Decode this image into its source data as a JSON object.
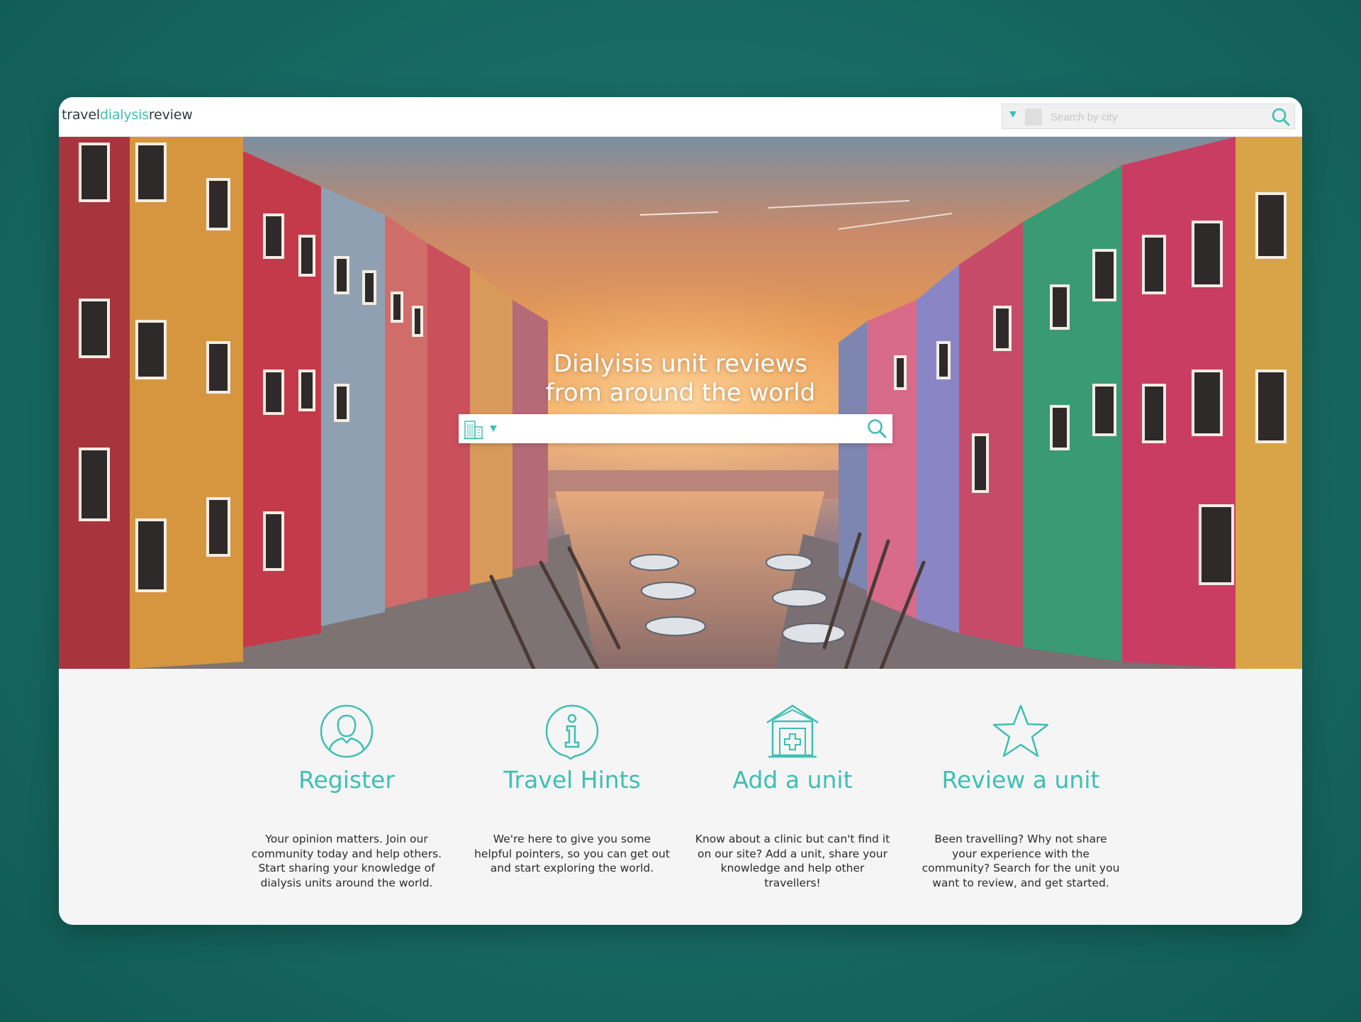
{
  "colors": {
    "accent": "#3fbfb3",
    "background": "#176a63",
    "card": "#f5f5f5",
    "text": "#2b2b2b"
  },
  "header": {
    "logo_parts": [
      "travel",
      "dialysis",
      "review"
    ],
    "search_placeholder": "Search by city",
    "search_icon": "search-icon"
  },
  "hero": {
    "title_line1": "Dialyisis unit reviews",
    "title_line2": "from around the world",
    "search_type_icon": "building-icon",
    "search_icon": "search-icon",
    "search_value": ""
  },
  "features": [
    {
      "icon": "user-icon",
      "title": "Register",
      "description": "Your opinion matters. Join our community today and help others. Start sharing your knowledge of dialysis units around the world."
    },
    {
      "icon": "info-icon",
      "title": "Travel Hints",
      "description": "We're here to give you some helpful pointers, so you can get out and start exploring the world."
    },
    {
      "icon": "clinic-icon",
      "title": "Add a unit",
      "description": "Know about a clinic but can't find it on our site? Add a unit, share your knowledge and help other travellers!"
    },
    {
      "icon": "star-icon",
      "title": "Review a unit",
      "description": "Been travelling?  Why not share your experience with the community? Search for the unit you want to review, and get started."
    }
  ]
}
